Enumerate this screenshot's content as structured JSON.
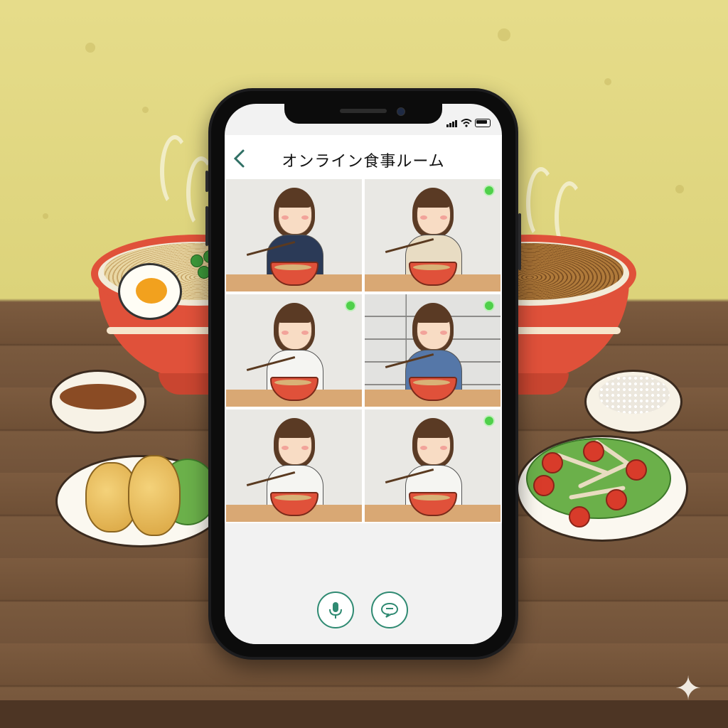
{
  "app": {
    "title": "オンライン食事ルーム"
  },
  "participants": [
    {
      "name": "participant-1",
      "online": false,
      "outfit": "#2b3a57"
    },
    {
      "name": "participant-2",
      "online": true,
      "outfit": "#e8dcc3"
    },
    {
      "name": "participant-3",
      "online": true,
      "outfit": "#f5f5f2"
    },
    {
      "name": "participant-4",
      "online": true,
      "outfit": "#5577a8"
    },
    {
      "name": "participant-5",
      "online": false,
      "outfit": "#f5f5f2"
    },
    {
      "name": "participant-6",
      "online": true,
      "outfit": "#f5f5f2"
    }
  ],
  "controls": {
    "icons": [
      "microphone-icon",
      "chat-bubble-icon"
    ]
  },
  "colors": {
    "accent": "#2f8a72",
    "online": "#4fd04a",
    "bowl": "#e0513a"
  }
}
